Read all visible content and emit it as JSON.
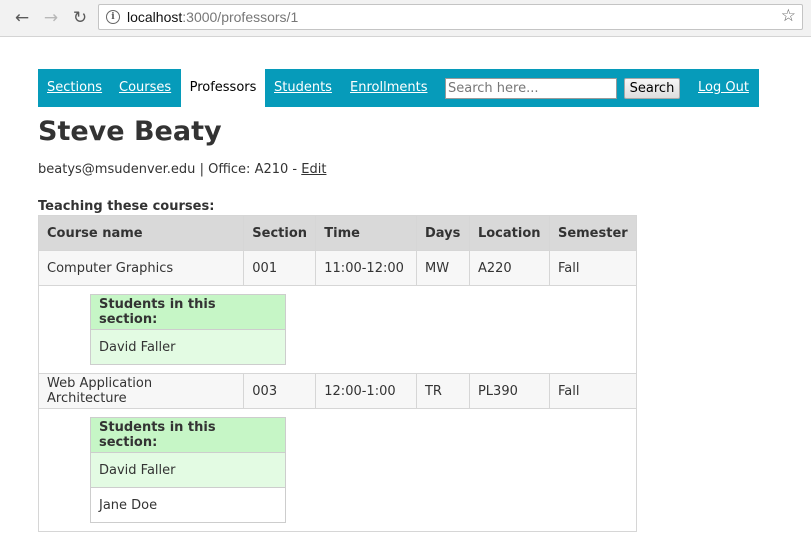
{
  "browser": {
    "url_host": "localhost",
    "url_path": ":3000/professors/1"
  },
  "nav": {
    "links": [
      "Sections",
      "Courses",
      "Professors",
      "Students",
      "Enrollments"
    ],
    "active": "Professors",
    "search_placeholder": "Search here...",
    "search_button": "Search",
    "logout": "Log Out"
  },
  "professor": {
    "name": "Steve Beaty",
    "email": "beatys@msudenver.edu",
    "separator": "|",
    "office_label": "Office:",
    "office": "A210",
    "dash": "-",
    "edit": "Edit"
  },
  "teaching_heading": "Teaching these courses:",
  "table": {
    "headers": [
      "Course name",
      "Section",
      "Time",
      "Days",
      "Location",
      "Semester"
    ],
    "rows": [
      {
        "cells": [
          "Computer Graphics",
          "001",
          "11:00-12:00",
          "MW",
          "A220",
          "Fall"
        ],
        "students_heading": "Students in this section:",
        "students": [
          "David Faller"
        ]
      },
      {
        "cells": [
          "Web Application Architecture",
          "003",
          "12:00-1:00",
          "TR",
          "PL390",
          "Fall"
        ],
        "students_heading": "Students in this section:",
        "students": [
          "David Faller",
          "Jane Doe"
        ]
      }
    ]
  }
}
